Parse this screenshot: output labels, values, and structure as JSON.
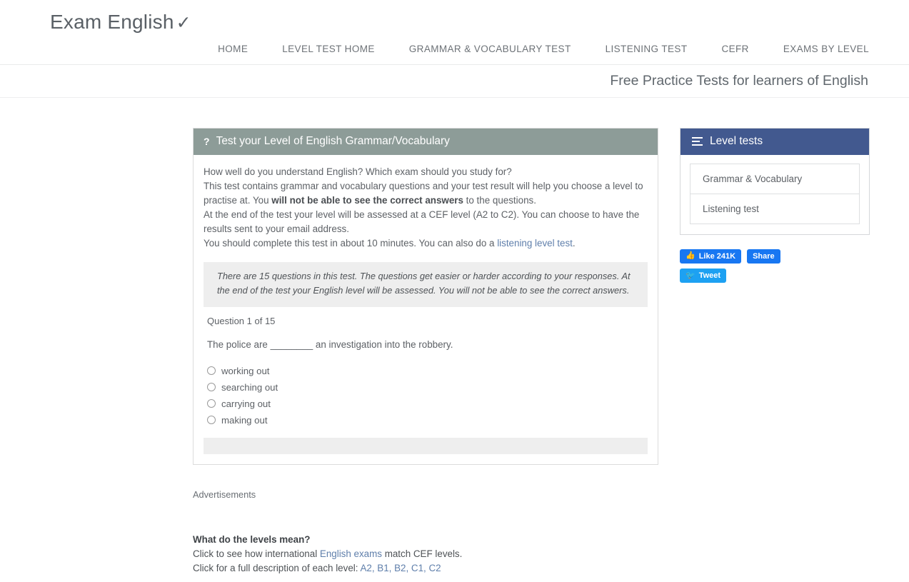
{
  "header": {
    "brand": "Exam English",
    "brand_tick": "✓",
    "nav": [
      {
        "label": "HOME",
        "name": "nav-home"
      },
      {
        "label": "LEVEL TEST HOME",
        "name": "nav-level-test-home"
      },
      {
        "label": "GRAMMAR & VOCABULARY TEST",
        "name": "nav-grammar-vocabulary-test"
      },
      {
        "label": "LISTENING TEST",
        "name": "nav-listening-test"
      },
      {
        "label": "CEFR",
        "name": "nav-cefr"
      },
      {
        "label": "EXAMS BY LEVEL",
        "name": "nav-exams-by-level"
      }
    ],
    "tagline": "Free Practice Tests for learners of English"
  },
  "quiz": {
    "header_icon": "?",
    "header_title": "Test your Level of English Grammar/Vocabulary",
    "intro_line1": "How well do you understand English? Which exam should you study for?",
    "intro_line2_a": "This test contains grammar and vocabulary questions and your test result will help you choose a level to practise at. You ",
    "intro_line2_bold": "will not be able to see the correct answers",
    "intro_line2_b": " to the questions.",
    "intro_line3": "At the end of the test your level will be assessed at a CEF level (A2 to C2). You can choose to have the results sent to your email address.",
    "intro_line4_a": "You should complete this test in about 10 minutes. You can also do a ",
    "intro_line4_link": "listening level test",
    "intro_line4_b": ".",
    "info_box": "There are 15 questions in this test. The questions get easier or harder according to your responses. At the end of the test your English level will be assessed. You will not be able to see the correct answers.",
    "question_counter": "Question 1 of 15",
    "question_text": "The police are ________ an investigation into the robbery.",
    "options": [
      {
        "label": "working out"
      },
      {
        "label": "searching out"
      },
      {
        "label": "carrying out"
      },
      {
        "label": "making out"
      }
    ]
  },
  "sidebar": {
    "header_title": "Level tests",
    "items": [
      {
        "label": "Grammar & Vocabulary"
      },
      {
        "label": "Listening test"
      }
    ],
    "social": {
      "like_label": "Like 241K",
      "share_label": "Share",
      "tweet_label": "Tweet",
      "like_icon": "👍",
      "tweet_icon": "🐦"
    }
  },
  "lower": {
    "ads_label": "Advertisements",
    "levels_heading": "What do the levels mean?",
    "levels_line1_a": "Click to see how international ",
    "levels_line1_link": "English exams",
    "levels_line1_b": " match CEF levels.",
    "levels_line2_a": "Click for a full description of each level: ",
    "levels_line2_links": "A2, B1, B2, C1, C2"
  },
  "colors": {
    "quiz_header": "#8d9c98",
    "sidebar_header": "#42598f",
    "link": "#5f7fab",
    "facebook": "#1877f2",
    "twitter": "#1da1f2"
  }
}
